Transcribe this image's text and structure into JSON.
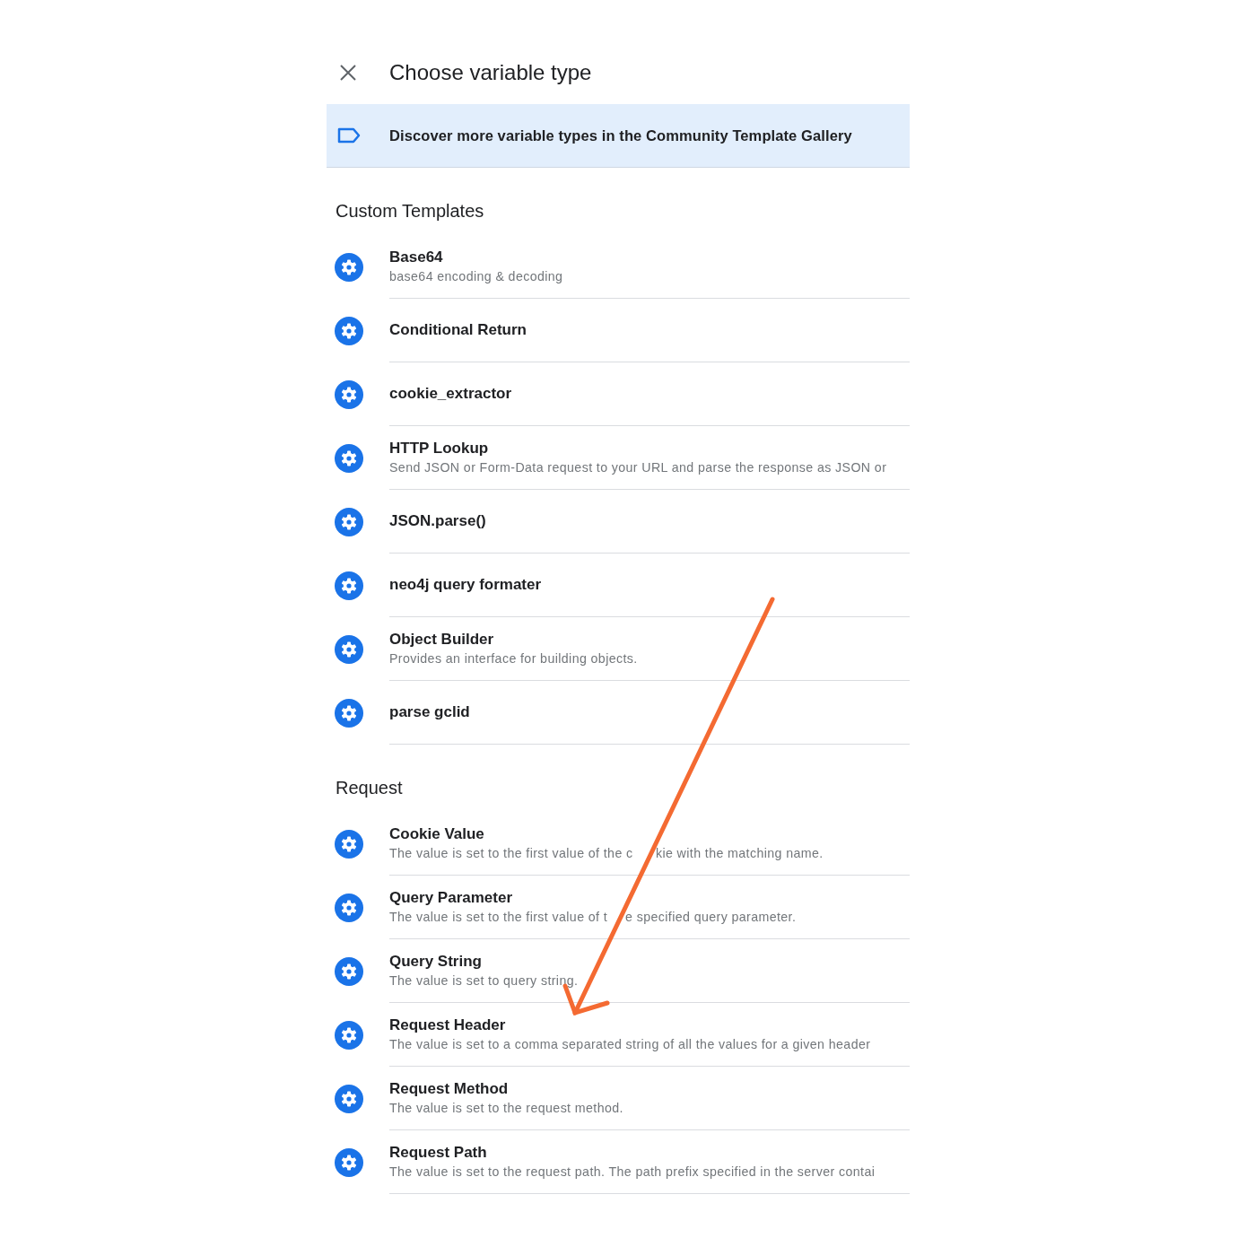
{
  "dialog": {
    "title": "Choose variable type"
  },
  "banner": {
    "text": "Discover more variable types in the Community Template Gallery"
  },
  "sections": [
    {
      "heading": "Custom Templates",
      "items": [
        {
          "title": "Base64",
          "description": "base64 encoding & decoding"
        },
        {
          "title": "Conditional Return"
        },
        {
          "title": "cookie_extractor"
        },
        {
          "title": "HTTP Lookup",
          "description": "Send JSON or Form-Data request to your URL and parse the response as JSON or"
        },
        {
          "title": "JSON.parse()"
        },
        {
          "title": "neo4j query formater"
        },
        {
          "title": "Object Builder",
          "description": "Provides an interface for building objects."
        },
        {
          "title": "parse gclid"
        }
      ]
    },
    {
      "heading": "Request",
      "items": [
        {
          "title": "Cookie Value",
          "description": [
            "The value is set to the first value of the c",
            "kie with the matching name."
          ]
        },
        {
          "title": "Query Parameter",
          "description": [
            "The value is set to the first value of t",
            "e specified query parameter."
          ]
        },
        {
          "title": "Query String",
          "description": "The value is set to query string."
        },
        {
          "title": "Request Header",
          "description": "The value is set to a comma separated string of all the values for a given header"
        },
        {
          "title": "Request Method",
          "description": "The value is set to the request method."
        },
        {
          "title": "Request Path",
          "description": "The value is set to the request path. The path prefix specified in the server contai"
        }
      ]
    }
  ]
}
